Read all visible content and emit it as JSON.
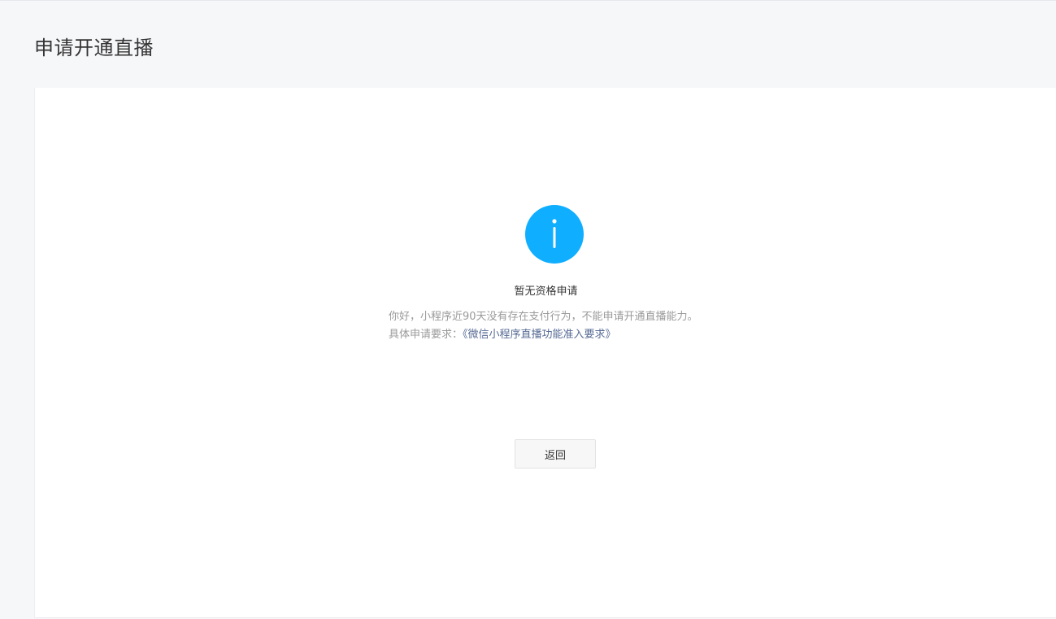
{
  "page": {
    "title": "申请开通直播"
  },
  "status": {
    "icon": "info-icon",
    "icon_color": "#10aeff",
    "title": "暂无资格申请",
    "description_line1": "你好，小程序近90天没有存在支付行为，不能申请开通直播能力。",
    "description_line2_prefix": "具体申请要求：",
    "requirements_link": "《微信小程序直播功能准入要求》",
    "link_color": "#576b95"
  },
  "actions": {
    "back_label": "返回"
  }
}
